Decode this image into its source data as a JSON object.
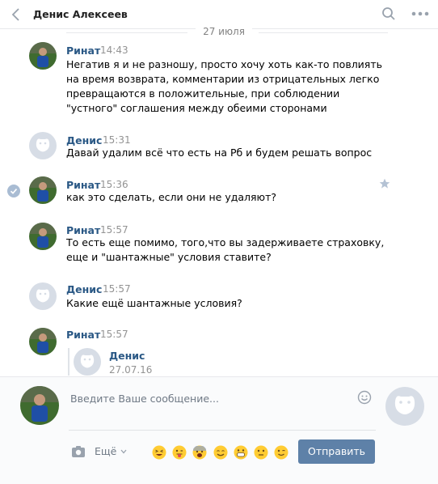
{
  "header": {
    "title": "Денис Алексеев",
    "back_icon": "chevron-left-icon",
    "search_icon": "search-icon",
    "more_icon": "more-icon"
  },
  "date_separator": "27 июля",
  "messages": [
    {
      "author": "Ринат",
      "time": "14:43",
      "text": "Негатив я и не разношу, просто хочу хоть как-то повлиять на время возврата, комментарии из отрицательных легко превращаются в положительные, при соблюдении \"устного\" соглашения между обеими сторонами"
    },
    {
      "author": "Денис",
      "time": "15:31",
      "text": "Давай удалим всё что есть на Рб и будем решать вопрос"
    },
    {
      "author": "Ринат",
      "time": "15:36",
      "text": "как это сделать, если они не удаляют?"
    },
    {
      "author": "Ринат",
      "time": "15:57",
      "text": "То есть еще помимо, того,что вы задерживаете страховку, еще и \"шантажные\" условия ставите?"
    },
    {
      "author": "Денис",
      "time": "15:57",
      "text": "Какие ещё шантажные условия?"
    },
    {
      "author": "Ринат",
      "time": "15:57",
      "text": ""
    }
  ],
  "forwarded": {
    "author": "Денис",
    "date": "27.07.16"
  },
  "composer": {
    "placeholder": "Введите Ваше сообщение...",
    "more_label": "Ещё",
    "send_label": "Отправить"
  },
  "colors": {
    "link": "#2a5885",
    "button": "#5e81a8",
    "time": "#939393"
  }
}
